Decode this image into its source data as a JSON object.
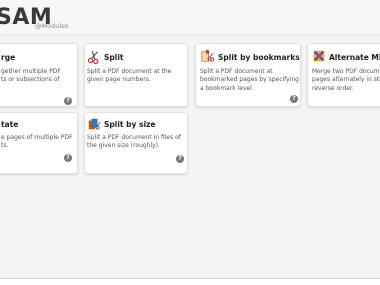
{
  "header": {
    "logo": "SAM",
    "logo_suffix": "@Modules"
  },
  "modules": [
    {
      "id": "merge",
      "title": "rge",
      "desc": [
        "gether multiple PDF",
        "ts or subsections of"
      ],
      "help": "?"
    },
    {
      "id": "split",
      "title": "Split",
      "icon": "scissors-icon",
      "desc": [
        "Split a PDF document at the",
        "given page numbers."
      ],
      "help": "?"
    },
    {
      "id": "split-by-bookmarks",
      "title": "Split by bookmarks",
      "icon": "bookmark-split-icon",
      "desc": [
        "Split a PDF document at",
        "bookmarked pages by specifying",
        "a bookmark level."
      ],
      "help": "?"
    },
    {
      "id": "alternate-mix",
      "title": "Alternate Mix",
      "icon": "alternate-mix-icon",
      "desc": [
        "Merge two PDF docume",
        "pages alternately in str",
        "reverse order."
      ],
      "help": "?"
    },
    {
      "id": "rotate",
      "title": "tate",
      "desc": [
        "e pages of multiple PDF",
        "ts."
      ],
      "help": "?"
    },
    {
      "id": "split-by-size",
      "title": "Split by size",
      "icon": "split-by-size-icon",
      "desc": [
        "Split a PDF document in files of",
        "the given size (roughly)."
      ],
      "help": "?"
    }
  ]
}
